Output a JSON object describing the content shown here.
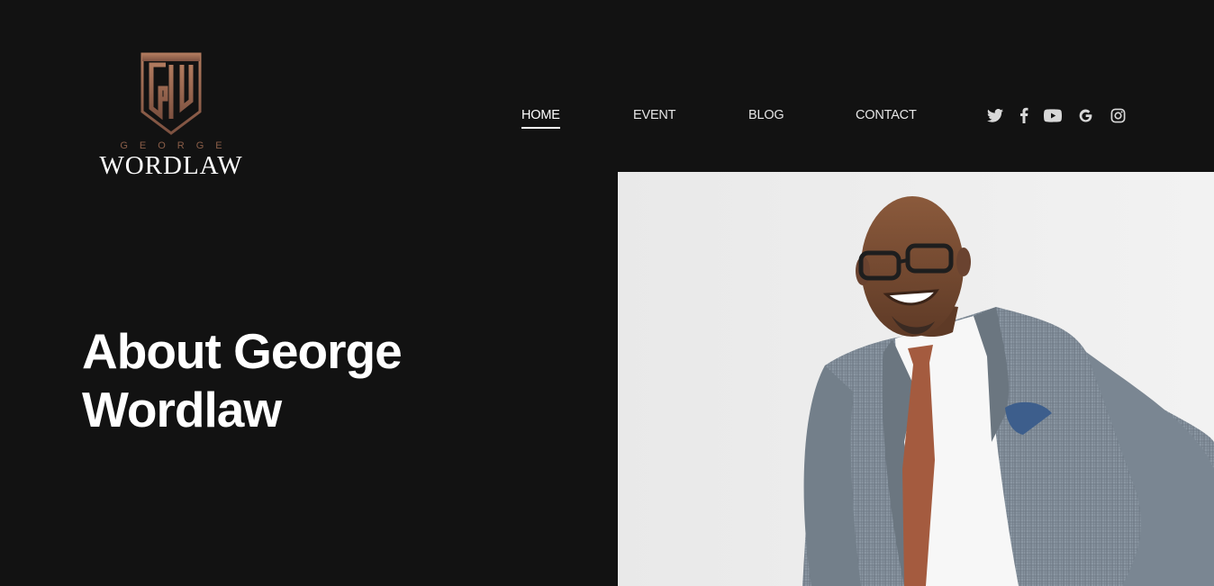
{
  "logo": {
    "top_text": "GEORGE",
    "bottom_text": "WORDLAW",
    "mark_letters": "GW"
  },
  "nav": {
    "items": [
      {
        "label": "HOME",
        "active": true
      },
      {
        "label": "EVENT",
        "active": false
      },
      {
        "label": "BLOG",
        "active": false
      },
      {
        "label": "CONTACT",
        "active": false
      }
    ]
  },
  "social": {
    "icons": [
      "twitter-icon",
      "facebook-icon",
      "youtube-icon",
      "google-icon",
      "instagram-icon"
    ]
  },
  "hero": {
    "title_line1": "About George",
    "title_line2": "Wordlaw"
  },
  "colors": {
    "background": "#121212",
    "accent_bronze": "#9a6a52",
    "text": "#ffffff"
  }
}
